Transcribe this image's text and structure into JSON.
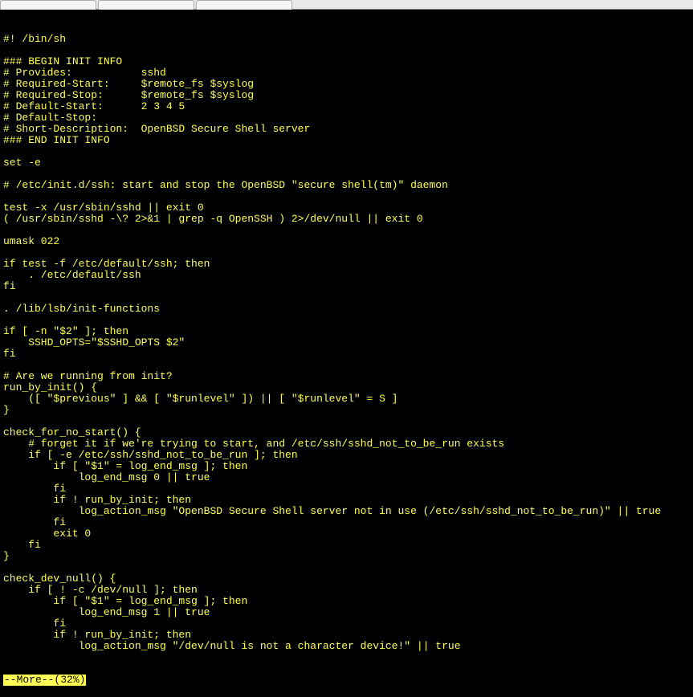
{
  "tabs": [
    {
      "label": ""
    },
    {
      "label": ""
    },
    {
      "label": ""
    }
  ],
  "script_lines": [
    "#! /bin/sh",
    "",
    "### BEGIN INIT INFO",
    "# Provides:           sshd",
    "# Required-Start:     $remote_fs $syslog",
    "# Required-Stop:      $remote_fs $syslog",
    "# Default-Start:      2 3 4 5",
    "# Default-Stop:",
    "# Short-Description:  OpenBSD Secure Shell server",
    "### END INIT INFO",
    "",
    "set -e",
    "",
    "# /etc/init.d/ssh: start and stop the OpenBSD \"secure shell(tm)\" daemon",
    "",
    "test -x /usr/sbin/sshd || exit 0",
    "( /usr/sbin/sshd -\\? 2>&1 | grep -q OpenSSH ) 2>/dev/null || exit 0",
    "",
    "umask 022",
    "",
    "if test -f /etc/default/ssh; then",
    "    . /etc/default/ssh",
    "fi",
    "",
    ". /lib/lsb/init-functions",
    "",
    "if [ -n \"$2\" ]; then",
    "    SSHD_OPTS=\"$SSHD_OPTS $2\"",
    "fi",
    "",
    "# Are we running from init?",
    "run_by_init() {",
    "    ([ \"$previous\" ] && [ \"$runlevel\" ]) || [ \"$runlevel\" = S ]",
    "}",
    "",
    "check_for_no_start() {",
    "    # forget it if we're trying to start, and /etc/ssh/sshd_not_to_be_run exists",
    "    if [ -e /etc/ssh/sshd_not_to_be_run ]; then",
    "        if [ \"$1\" = log_end_msg ]; then",
    "            log_end_msg 0 || true",
    "        fi",
    "        if ! run_by_init; then",
    "            log_action_msg \"OpenBSD Secure Shell server not in use (/etc/ssh/sshd_not_to_be_run)\" || true",
    "        fi",
    "        exit 0",
    "    fi",
    "}",
    "",
    "check_dev_null() {",
    "    if [ ! -c /dev/null ]; then",
    "        if [ \"$1\" = log_end_msg ]; then",
    "            log_end_msg 1 || true",
    "        fi",
    "        if ! run_by_init; then",
    "            log_action_msg \"/dev/null is not a character device!\" || true"
  ],
  "status_text": "--More--(32%)"
}
